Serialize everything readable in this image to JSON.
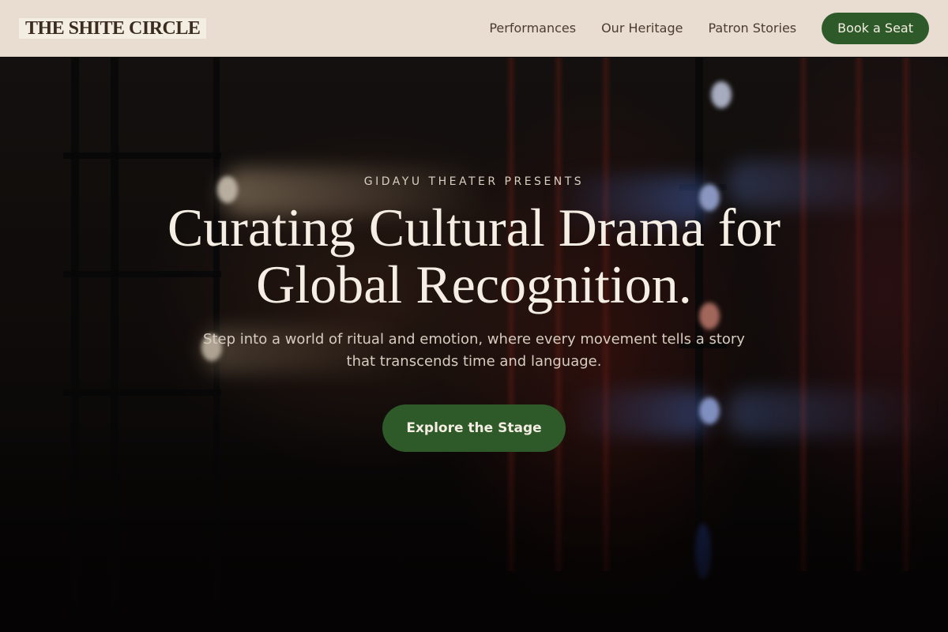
{
  "nav": {
    "logo": "THE SHITE CIRCLE",
    "links": [
      "Performances",
      "Our Heritage",
      "Patron Stories"
    ],
    "cta": "Book a Seat"
  },
  "hero": {
    "eyebrow": "GIDAYU THEATER PRESENTS",
    "headline_line1": "Curating Cultural Drama for",
    "headline_line2": "Global Recognition.",
    "subtitle": "Step into a world of ritual and emotion, where every movement tells a story that transcends time and language.",
    "cta": "Explore the Stage"
  },
  "colors": {
    "nav_bg": "#e8ddd0",
    "accent_green": "#2e5a2a",
    "headline": "#f5eee4"
  }
}
